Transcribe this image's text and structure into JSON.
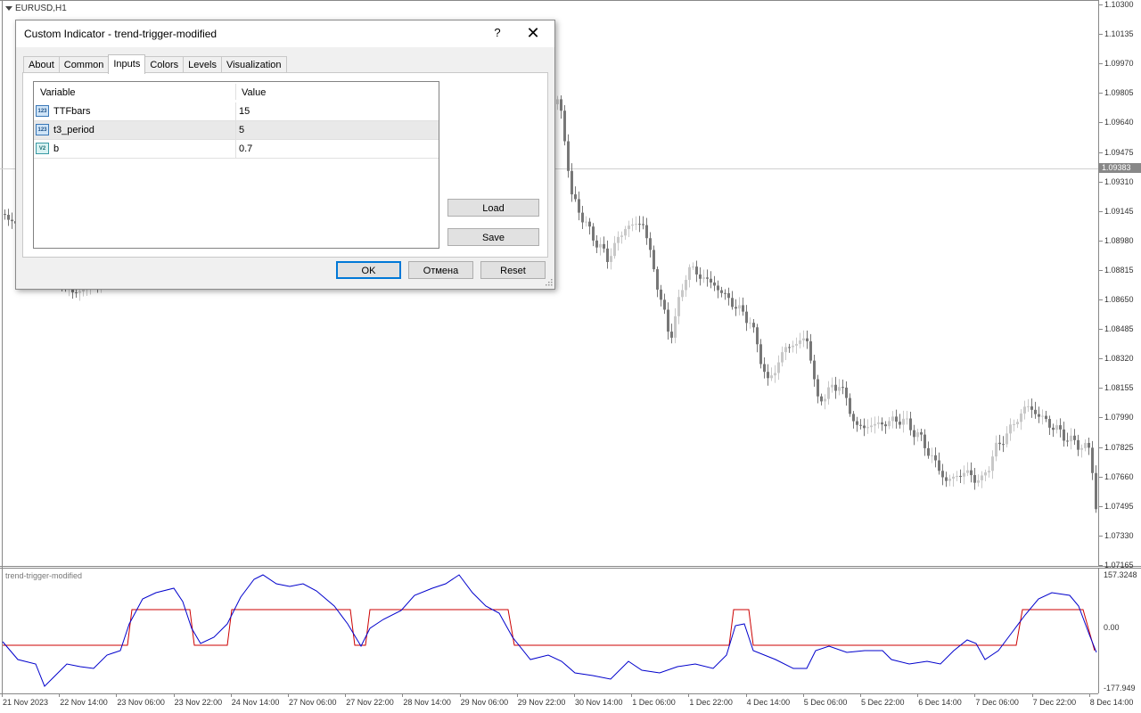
{
  "chart": {
    "symbol": "EURUSD,H1",
    "current_price": "1.09383",
    "price_labels": [
      "1.10300",
      "1.10135",
      "1.09970",
      "1.09805",
      "1.09640",
      "1.09475",
      "1.09310",
      "1.09145",
      "1.08980",
      "1.08815",
      "1.08650",
      "1.08485",
      "1.08320",
      "1.08155",
      "1.07990",
      "1.07825",
      "1.07660",
      "1.07495",
      "1.07330",
      "1.07165"
    ],
    "time_labels": [
      "21 Nov 2023",
      "22 Nov 14:00",
      "23 Nov 06:00",
      "23 Nov 22:00",
      "24 Nov 14:00",
      "27 Nov 06:00",
      "27 Nov 22:00",
      "28 Nov 14:00",
      "29 Nov 06:00",
      "29 Nov 22:00",
      "30 Nov 14:00",
      "1 Dec 06:00",
      "1 Dec 22:00",
      "4 Dec 14:00",
      "5 Dec 06:00",
      "5 Dec 22:00",
      "6 Dec 14:00",
      "7 Dec 06:00",
      "7 Dec 22:00",
      "8 Dec 14:00"
    ],
    "bull_color": "#c8c8c8",
    "bear_color": "#777777"
  },
  "subwindow": {
    "name": "trend-trigger-modified",
    "scale_top": "157.3248",
    "scale_mid": "0.00",
    "scale_bottom": "-177.949",
    "trigger_color": "#cc0000",
    "line_color": "#0000cc"
  },
  "dialog": {
    "title": "Custom Indicator - trend-trigger-modified",
    "help": "?",
    "close": "✕",
    "tabs": [
      "About",
      "Common",
      "Inputs",
      "Colors",
      "Levels",
      "Visualization"
    ],
    "active_tab": "Inputs",
    "grid": {
      "col_variable": "Variable",
      "col_value": "Value",
      "rows": [
        {
          "icon": "123",
          "variable": "TTFbars",
          "value": "15"
        },
        {
          "icon": "123",
          "variable": "t3_period",
          "value": "5"
        },
        {
          "icon": "V2",
          "variable": "b",
          "value": "0.7"
        }
      ]
    },
    "load": "Load",
    "save": "Save",
    "ok": "OK",
    "cancel": "Отмена",
    "reset": "Reset"
  }
}
